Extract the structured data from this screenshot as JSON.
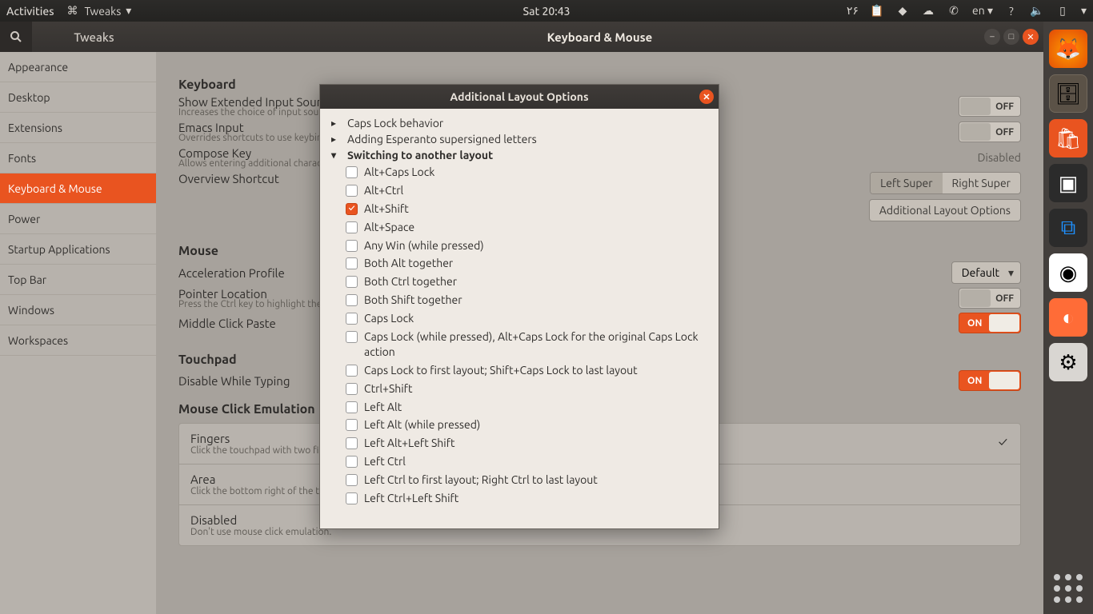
{
  "topbar": {
    "activities": "Activities",
    "app": "Tweaks",
    "clock": "Sat 20:43",
    "lang": "en",
    "persian_num": "۲۶"
  },
  "window": {
    "search_label": "Search",
    "app_title": "Tweaks",
    "page_title": "Keyboard & Mouse"
  },
  "sidebar": {
    "items": [
      {
        "label": "Appearance"
      },
      {
        "label": "Desktop"
      },
      {
        "label": "Extensions"
      },
      {
        "label": "Fonts"
      },
      {
        "label": "Keyboard & Mouse",
        "selected": true
      },
      {
        "label": "Power"
      },
      {
        "label": "Startup Applications"
      },
      {
        "label": "Top Bar"
      },
      {
        "label": "Windows"
      },
      {
        "label": "Workspaces"
      }
    ]
  },
  "main": {
    "keyboard": {
      "heading": "Keyboard",
      "extended": {
        "label": "Show Extended Input Sources",
        "sub": "Increases the choice of input sources",
        "value": "OFF"
      },
      "emacs": {
        "label": "Emacs Input",
        "sub": "Overrides shortcuts to use keybindings",
        "value": "OFF"
      },
      "compose": {
        "label": "Compose Key",
        "sub": "Allows entering additional characters",
        "value": "Disabled"
      },
      "overview": {
        "label": "Overview Shortcut",
        "left": "Left Super",
        "right": "Right Super",
        "btn": "Additional Layout Options"
      }
    },
    "mouse": {
      "heading": "Mouse",
      "accel": {
        "label": "Acceleration Profile",
        "value": "Default"
      },
      "pointer": {
        "label": "Pointer Location",
        "sub": "Press the Ctrl key to highlight the pointer",
        "value": "OFF"
      },
      "middle": {
        "label": "Middle Click Paste",
        "value": "ON"
      }
    },
    "touchpad": {
      "heading": "Touchpad",
      "disable": {
        "label": "Disable While Typing",
        "value": "ON"
      }
    },
    "emulation": {
      "heading": "Mouse Click Emulation",
      "rows": [
        {
          "title": "Fingers",
          "sub": "Click the touchpad with two fingers",
          "selected": true
        },
        {
          "title": "Area",
          "sub": "Click the bottom right of the touchpad"
        },
        {
          "title": "Disabled",
          "sub": "Don't use mouse click emulation."
        }
      ]
    },
    "toggle_on": "ON",
    "toggle_off": "OFF"
  },
  "modal": {
    "title": "Additional Layout Options",
    "groups": [
      {
        "label": "Caps Lock behavior",
        "expanded": false
      },
      {
        "label": "Adding Esperanto supersigned letters",
        "expanded": false
      },
      {
        "label": "Switching to another layout",
        "expanded": true
      }
    ],
    "switching_options": [
      {
        "label": "Alt+Caps Lock",
        "checked": false
      },
      {
        "label": "Alt+Ctrl",
        "checked": false
      },
      {
        "label": "Alt+Shift",
        "checked": true
      },
      {
        "label": "Alt+Space",
        "checked": false
      },
      {
        "label": "Any Win (while pressed)",
        "checked": false
      },
      {
        "label": "Both Alt together",
        "checked": false
      },
      {
        "label": "Both Ctrl together",
        "checked": false
      },
      {
        "label": "Both Shift together",
        "checked": false
      },
      {
        "label": "Caps Lock",
        "checked": false
      },
      {
        "label": "Caps Lock (while pressed), Alt+Caps Lock for the original Caps Lock action",
        "checked": false
      },
      {
        "label": "Caps Lock to first layout; Shift+Caps Lock to last layout",
        "checked": false
      },
      {
        "label": "Ctrl+Shift",
        "checked": false
      },
      {
        "label": "Left Alt",
        "checked": false
      },
      {
        "label": "Left Alt (while pressed)",
        "checked": false
      },
      {
        "label": "Left Alt+Left Shift",
        "checked": false
      },
      {
        "label": "Left Ctrl",
        "checked": false
      },
      {
        "label": "Left Ctrl to first layout; Right Ctrl to last layout",
        "checked": false
      },
      {
        "label": "Left Ctrl+Left Shift",
        "checked": false
      }
    ]
  }
}
